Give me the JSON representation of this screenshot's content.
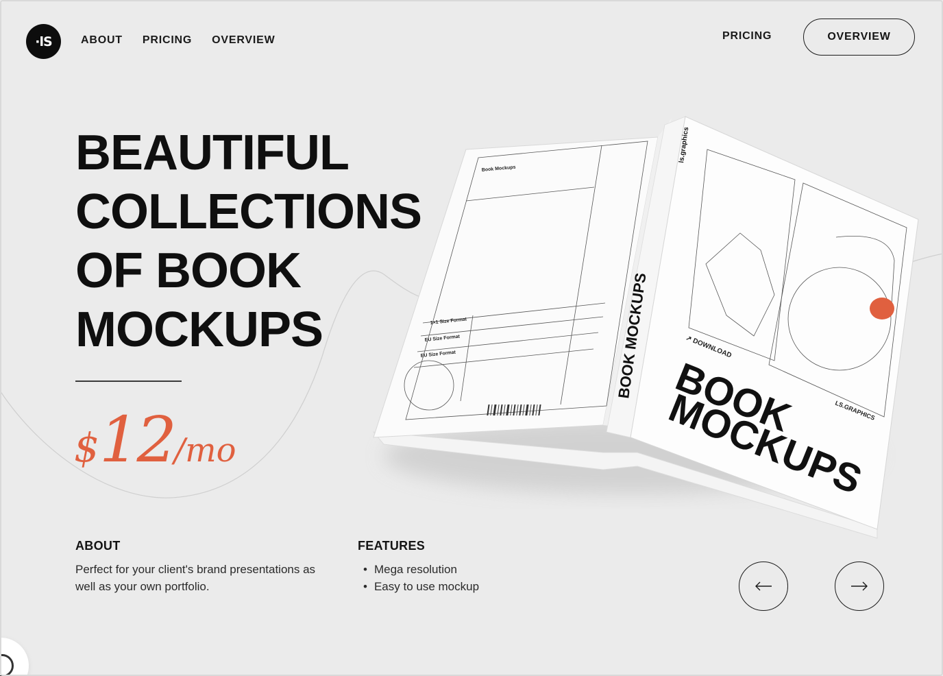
{
  "nav": {
    "logo_text": "·lS",
    "links": [
      "ABOUT",
      "PRICING",
      "OVERVIEW"
    ],
    "pricing_right": "PRICING",
    "overview_button": "OVERVIEW"
  },
  "hero": {
    "title_lines": [
      "BEAUTIFUL",
      "COLLECTIONS",
      "OF BOOK",
      "MOCKUPS"
    ],
    "price_currency": "$",
    "price_amount": "12",
    "price_period": "/mo"
  },
  "about": {
    "heading": "ABOUT",
    "text": "Perfect for your client's brand presentations as well as your own portfolio."
  },
  "features": {
    "heading": "FEATURES",
    "items": [
      "Mega resolution",
      "Easy to use mockup"
    ]
  },
  "book": {
    "spine_title": "BOOK MOCKUPS",
    "spine_brand": "ls.graphics",
    "cover_download": "↗ DOWNLOAD",
    "cover_title_1": "BOOK",
    "cover_title_2": "MOCKUPS",
    "cover_brand": "LS.GRAPHICS",
    "back_title": "Book Mockups",
    "back_rows": [
      "1×1 Size Format",
      "EU Size Format",
      "EU Size Format"
    ]
  },
  "colors": {
    "background": "#ebebeb",
    "accent": "#e0603f",
    "text": "#141414"
  },
  "icons": {
    "prev": "arrow-left-icon",
    "next": "arrow-right-icon",
    "chat": "chat-icon"
  }
}
